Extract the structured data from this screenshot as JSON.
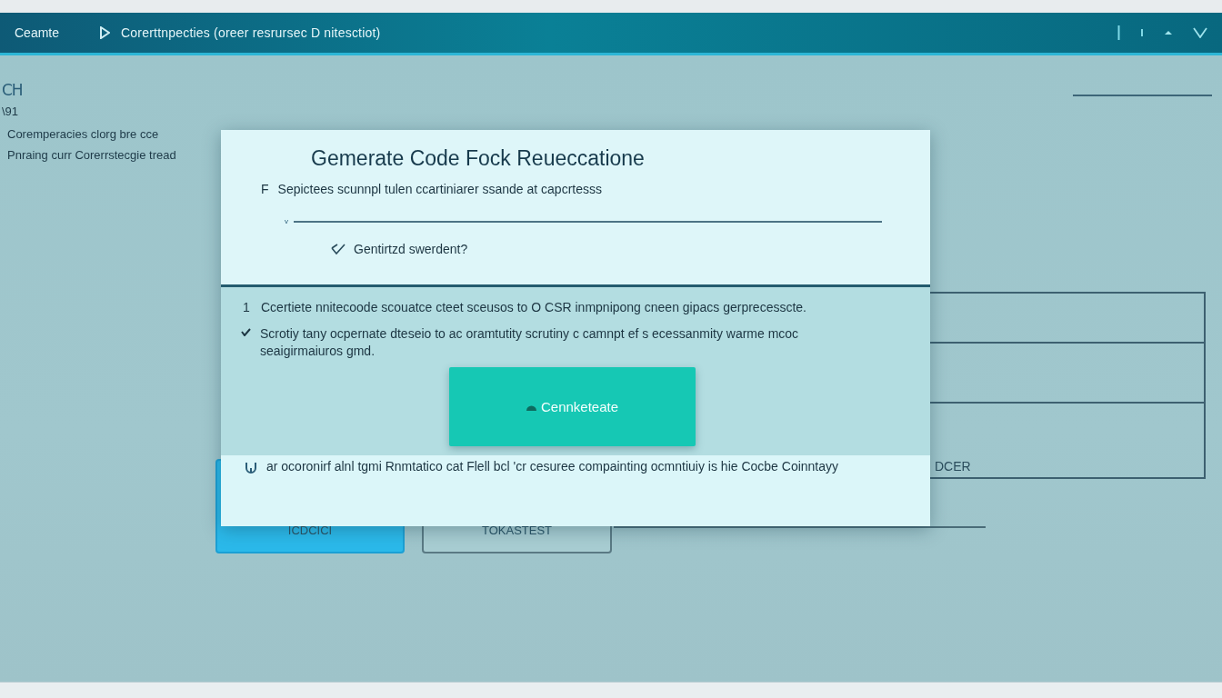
{
  "header": {
    "title": "Ceamte",
    "breadcrumb": "Corerttnpecties (oreer resrursec D nitesctiot)"
  },
  "sidebar": {
    "code": "CH",
    "subcode": "\\91",
    "lines": [
      "Coremperacies clorg bre cce",
      "Pnraing curr Corerrstecgie tread"
    ]
  },
  "buttons": [
    {
      "label": "ICDCICI",
      "kind": "primary"
    },
    {
      "label": "TOKASTEST",
      "kind": "secondary"
    }
  ],
  "table": {
    "text": "DCER"
  },
  "dialog": {
    "title": "Gemerate Code Fock Reueccatione",
    "prefix": "F",
    "subtitle": "Sepictees scunnpl tulen ccartiniarer ssande at capcrtesss",
    "field": {
      "marker": "v"
    },
    "option": {
      "label": "Gentirtzd swerdent?",
      "checked": true
    },
    "items": [
      {
        "kind": "numbered",
        "marker": "1",
        "text": "Ccertiete nnitecoode scouatce cteet sceusos to O CSR inmpnipong cneen gipacs gerprecesscte."
      },
      {
        "kind": "checked",
        "text": "Scrotiy tany ocpernate dteseio to ac oramtutity scrutiny c camnpt ef s ecessanmity warme mcoc seaigirmaiuros gmd."
      }
    ],
    "button": "Cennketeate",
    "note": "ar ocoronirf alnl tgmi Rnmtatico cat Flell bcl 'cr cesuree compainting ocmntiuiy is hie Cocbe Coinntayy"
  }
}
